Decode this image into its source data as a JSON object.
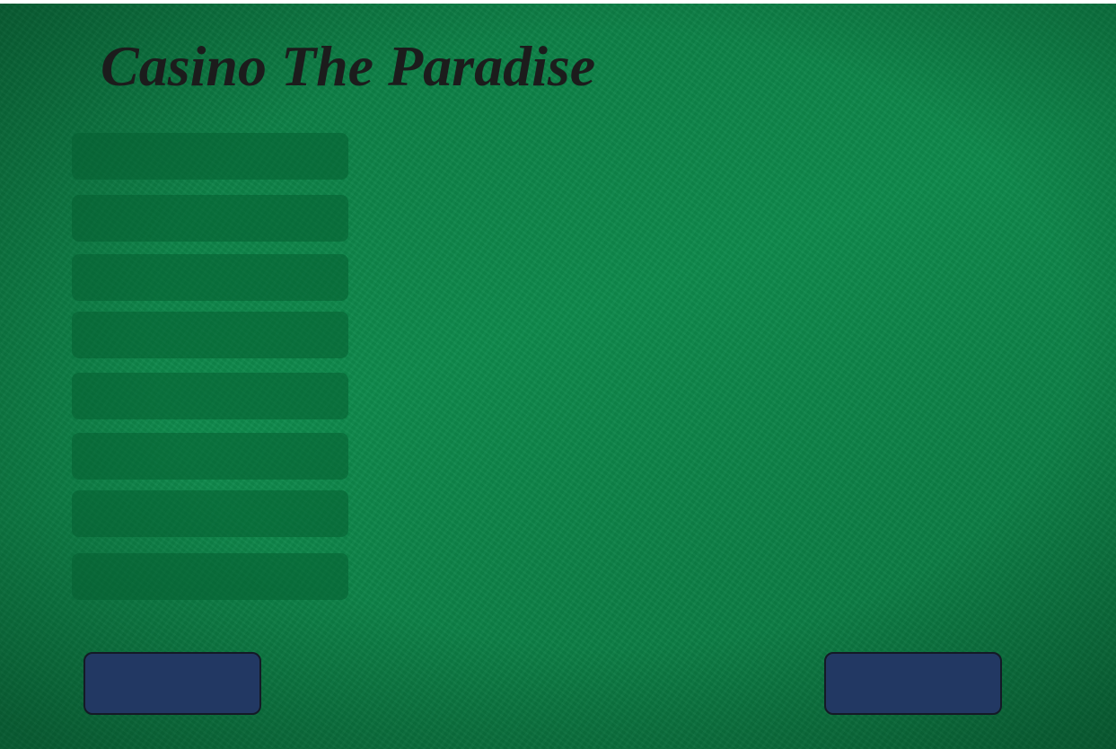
{
  "game": {
    "title": "Casino The Paradise"
  },
  "menu": {
    "items": [
      {
        "label": ""
      },
      {
        "label": ""
      },
      {
        "label": ""
      },
      {
        "label": ""
      },
      {
        "label": ""
      },
      {
        "label": ""
      },
      {
        "label": ""
      },
      {
        "label": ""
      }
    ]
  },
  "footer": {
    "left_button_label": "",
    "right_button_label": ""
  },
  "colors": {
    "table_felt": "#0e8a4c",
    "title_text": "#1c1c1c",
    "menu_item_fill": "#0a6b3c",
    "button_fill": "#223863",
    "button_border": "#141a26"
  }
}
